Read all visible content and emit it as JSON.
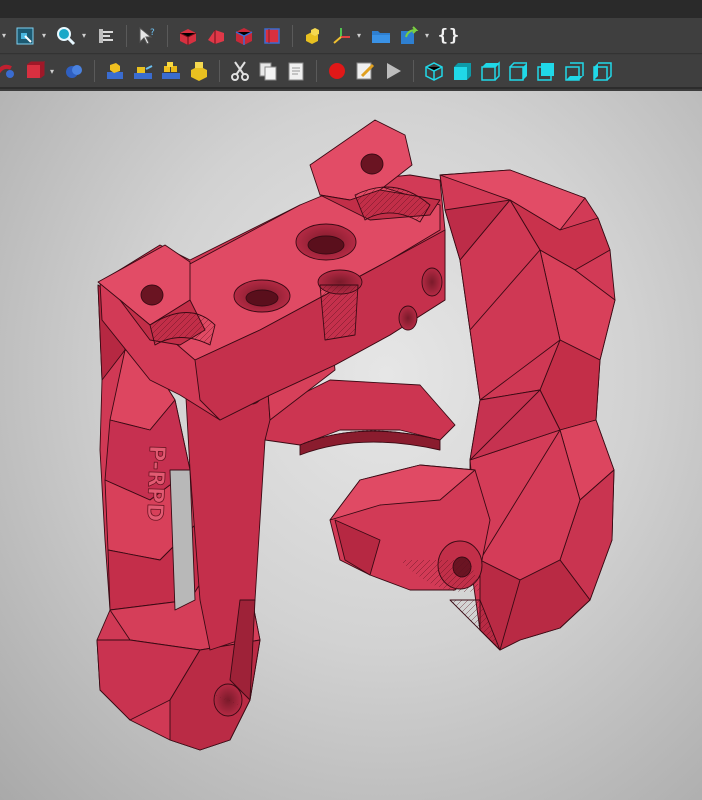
{
  "toolbar_top": {
    "icons": [
      "view-cube-icon",
      "zoom-icon",
      "measure-icon",
      "select-arrow-icon",
      "box-red-icon",
      "wedge-red-icon",
      "box-blue-icon",
      "cylinder-red-icon",
      "parts-yellow-icon",
      "axis-icon",
      "open-folder-icon",
      "export-icon"
    ],
    "code_label": "{}"
  },
  "toolbar_bottom": {
    "icons": [
      "lens-icon",
      "box-red-icon",
      "spheres-icon",
      "parts-blue-icon",
      "parts-stack-icon",
      "part-group-icon",
      "part-gold-icon",
      "cut-icon",
      "copy-icon",
      "paste-icon",
      "record-icon",
      "edit-macro-icon",
      "play-icon",
      "view-iso-icon",
      "view-front-icon",
      "view-top-icon",
      "view-right-icon",
      "view-rear-icon",
      "view-bottom-icon",
      "view-left-icon"
    ]
  },
  "viewport": {
    "model_text": "P-RPD",
    "model_color": "#d43a55",
    "background_color": "#d4d4d4"
  }
}
